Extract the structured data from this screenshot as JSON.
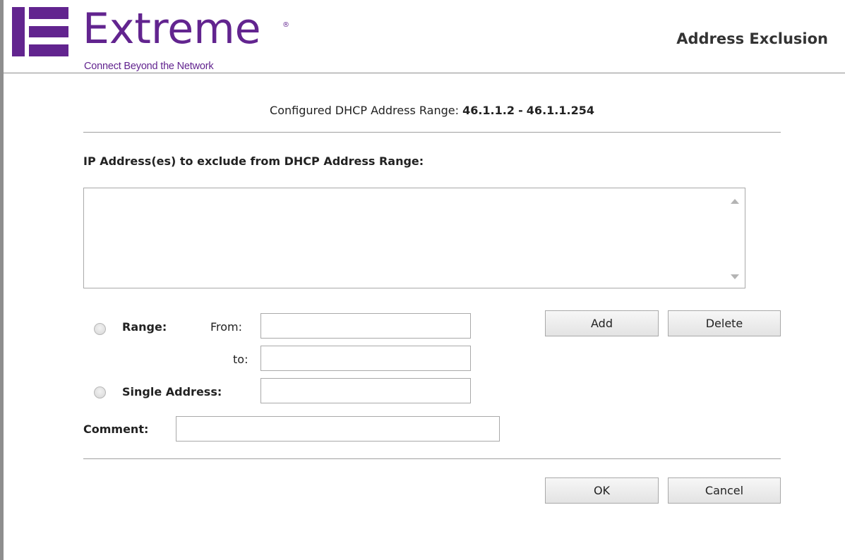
{
  "header": {
    "brand_name": "Extreme",
    "brand_registered": "®",
    "brand_tagline": "Connect Beyond the Network",
    "page_title": "Address Exclusion",
    "brand_color": "#62248f"
  },
  "range_info": {
    "label": "Configured DHCP Address Range:",
    "start": "46.1.1.2",
    "separator": "-",
    "end": "46.1.1.254"
  },
  "exclusion": {
    "section_label": "IP Address(es) to exclude from DHCP Address Range:",
    "list_items": []
  },
  "form": {
    "range_label": "Range:",
    "from_label": "From:",
    "from_value": "",
    "to_label": "to:",
    "to_value": "",
    "single_label": "Single Address:",
    "single_value": "",
    "comment_label": "Comment:",
    "comment_value": "",
    "range_selected": false,
    "single_selected": false
  },
  "buttons": {
    "add": "Add",
    "delete": "Delete",
    "ok": "OK",
    "cancel": "Cancel"
  }
}
